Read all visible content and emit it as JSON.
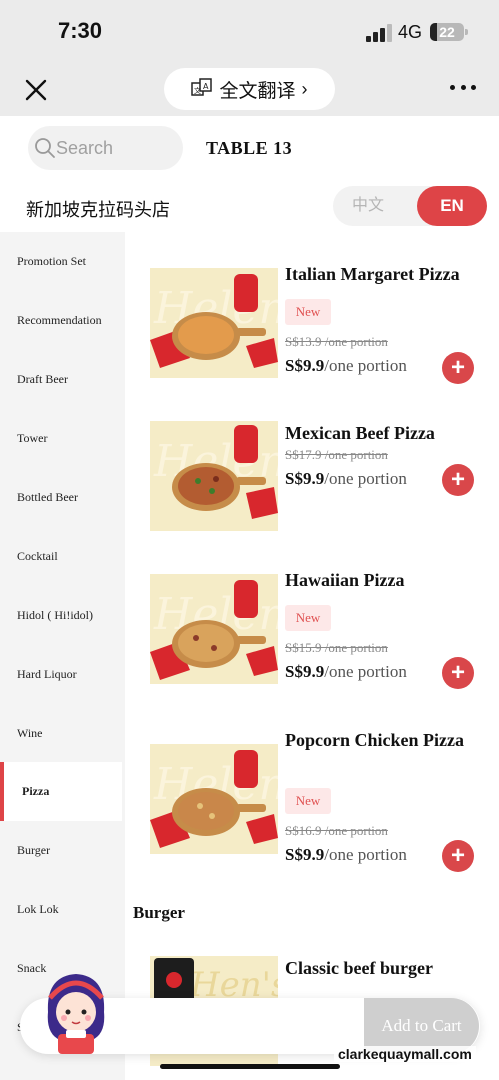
{
  "status_bar": {
    "time": "7:30",
    "network": "4G",
    "battery": "22",
    "battery_level": 0.22
  },
  "nav": {
    "translate_label": "全文翻译",
    "translate_chevron": "›"
  },
  "search": {
    "placeholder": "Search"
  },
  "table_label": "TABLE 13",
  "store_name": "新加坡克拉码头店",
  "lang": {
    "zh": "中文",
    "en": "EN",
    "selected": "EN"
  },
  "colors": {
    "accent": "#de4447",
    "badge_bg": "#fde8e8",
    "sidebar_bg": "#f4f4f4",
    "thumb_bg": "#f5ecc7"
  },
  "sidebar": {
    "items": [
      {
        "label": "Promotion Set"
      },
      {
        "label": "Recommendation"
      },
      {
        "label": "Draft Beer"
      },
      {
        "label": "Tower"
      },
      {
        "label": "Bottled Beer"
      },
      {
        "label": "Cocktail"
      },
      {
        "label": "Hidol ( Hi!idol)"
      },
      {
        "label": "Hard Liquor"
      },
      {
        "label": "Wine"
      },
      {
        "label": "Pizza"
      },
      {
        "label": "Burger"
      },
      {
        "label": "Lok Lok"
      },
      {
        "label": "Snack"
      },
      {
        "label": "S"
      }
    ],
    "active": "Pizza"
  },
  "products": [
    {
      "name": "Italian Margaret Pizza",
      "badge": "New",
      "old_price": "S$13.9 /one portion",
      "price": "S$9.9",
      "unit": "/one portion",
      "add": "+"
    },
    {
      "name": "Mexican Beef Pizza",
      "old_price": "S$17.9 /one portion",
      "price": "S$9.9",
      "unit": "/one portion",
      "add": "+"
    },
    {
      "name": "Hawaiian Pizza",
      "badge": "New",
      "old_price": "S$15.9 /one portion",
      "price": "S$9.9",
      "unit": "/one portion",
      "add": "+"
    },
    {
      "name": "Popcorn Chicken Pizza",
      "badge": "New",
      "old_price": "S$16.9 /one portion",
      "price": "S$9.9",
      "unit": "/one portion",
      "add": "+"
    },
    {
      "name": "Classic beef burger"
    }
  ],
  "section_burger": "Burger",
  "cart": {
    "add_label": "Add to Cart"
  },
  "watermark": "clarkequaymall.com"
}
